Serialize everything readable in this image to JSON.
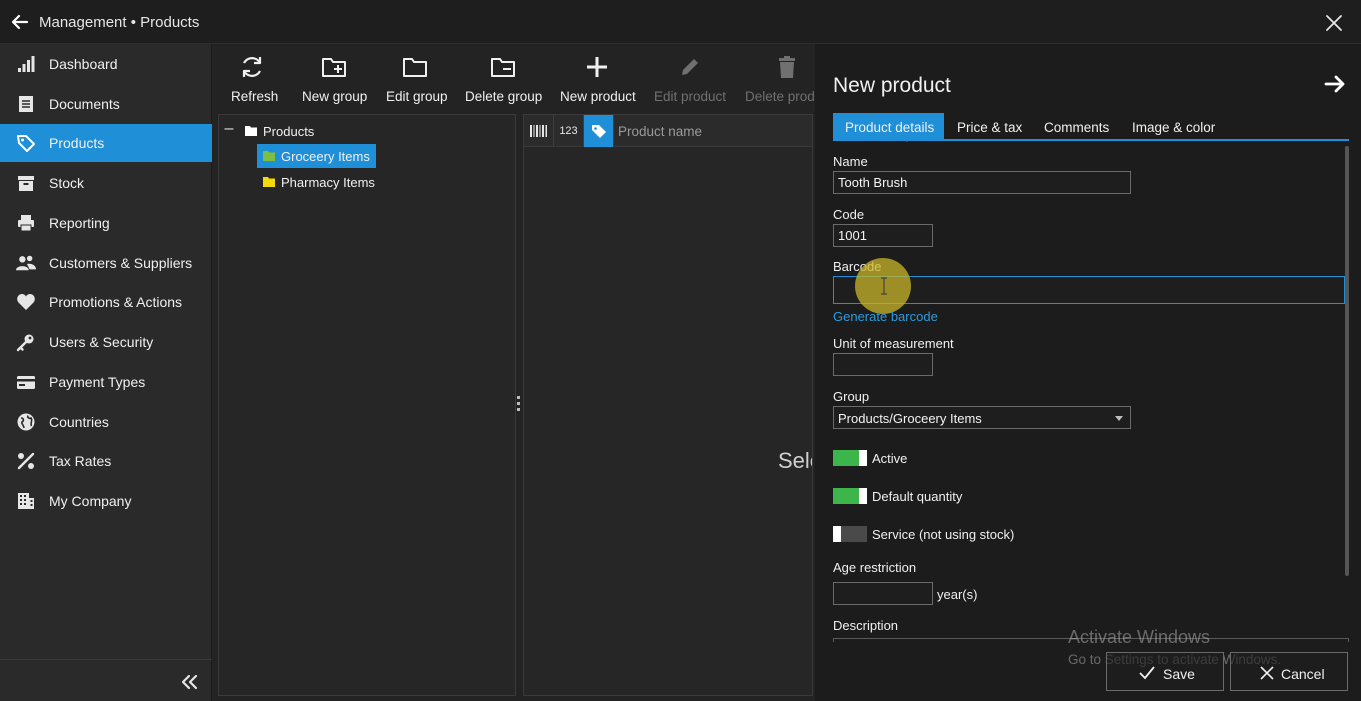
{
  "window": {
    "title": "Management • Products"
  },
  "sidebar": {
    "items": [
      {
        "label": "Dashboard",
        "icon": "bar-chart-icon"
      },
      {
        "label": "Documents",
        "icon": "document-icon"
      },
      {
        "label": "Products",
        "icon": "tag-icon",
        "active": true
      },
      {
        "label": "Stock",
        "icon": "archive-box-icon"
      },
      {
        "label": "Reporting",
        "icon": "printer-icon"
      },
      {
        "label": "Customers & Suppliers",
        "icon": "users-icon"
      },
      {
        "label": "Promotions & Actions",
        "icon": "heart-icon"
      },
      {
        "label": "Users & Security",
        "icon": "key-icon"
      },
      {
        "label": "Payment Types",
        "icon": "credit-card-icon"
      },
      {
        "label": "Countries",
        "icon": "globe-icon"
      },
      {
        "label": "Tax Rates",
        "icon": "percent-icon"
      },
      {
        "label": "My Company",
        "icon": "building-icon"
      }
    ]
  },
  "toolbar": {
    "refresh": "Refresh",
    "new_group": "New group",
    "edit_group": "Edit group",
    "delete_group": "Delete group",
    "new_product": "New product",
    "edit_product": "Edit product",
    "delete_product": "Delete product"
  },
  "tree": {
    "toggle": "–",
    "root": "Products",
    "children": [
      "Groceery Items",
      "Pharmacy Items"
    ],
    "colors": {
      "root_folder": "#ffffff",
      "selected_folder": "#7bc043",
      "folder": "#f5d90a"
    }
  },
  "grid": {
    "col_numeric": "123",
    "col_name": "Product name",
    "empty_message": "Select a product group"
  },
  "detail": {
    "title": "New product",
    "tabs": [
      "Product details",
      "Price & tax",
      "Comments",
      "Image & color"
    ],
    "fields": {
      "name_label": "Name",
      "name_value": "Tooth Brush",
      "code_label": "Code",
      "code_value": "1001",
      "barcode_label": "Barcode",
      "barcode_value": "",
      "generate_barcode": "Generate barcode",
      "uom_label": "Unit of measurement",
      "uom_value": "",
      "group_label": "Group",
      "group_value": "Products/Groceery Items",
      "active_label": "Active",
      "default_qty_label": "Default quantity",
      "service_label": "Service (not using stock)",
      "age_label": "Age restriction",
      "age_value": "",
      "age_unit": "year(s)",
      "description_label": "Description"
    },
    "toggles": {
      "active": true,
      "default_quantity": true,
      "service": false
    }
  },
  "footer": {
    "save": "Save",
    "cancel": "Cancel"
  },
  "watermark": {
    "line1": "Activate Windows",
    "line2": "Go to Settings to activate Windows."
  },
  "colors": {
    "accent": "#1f8fd8",
    "toggle_on": "#3cb54a",
    "link": "#2a9be0"
  }
}
